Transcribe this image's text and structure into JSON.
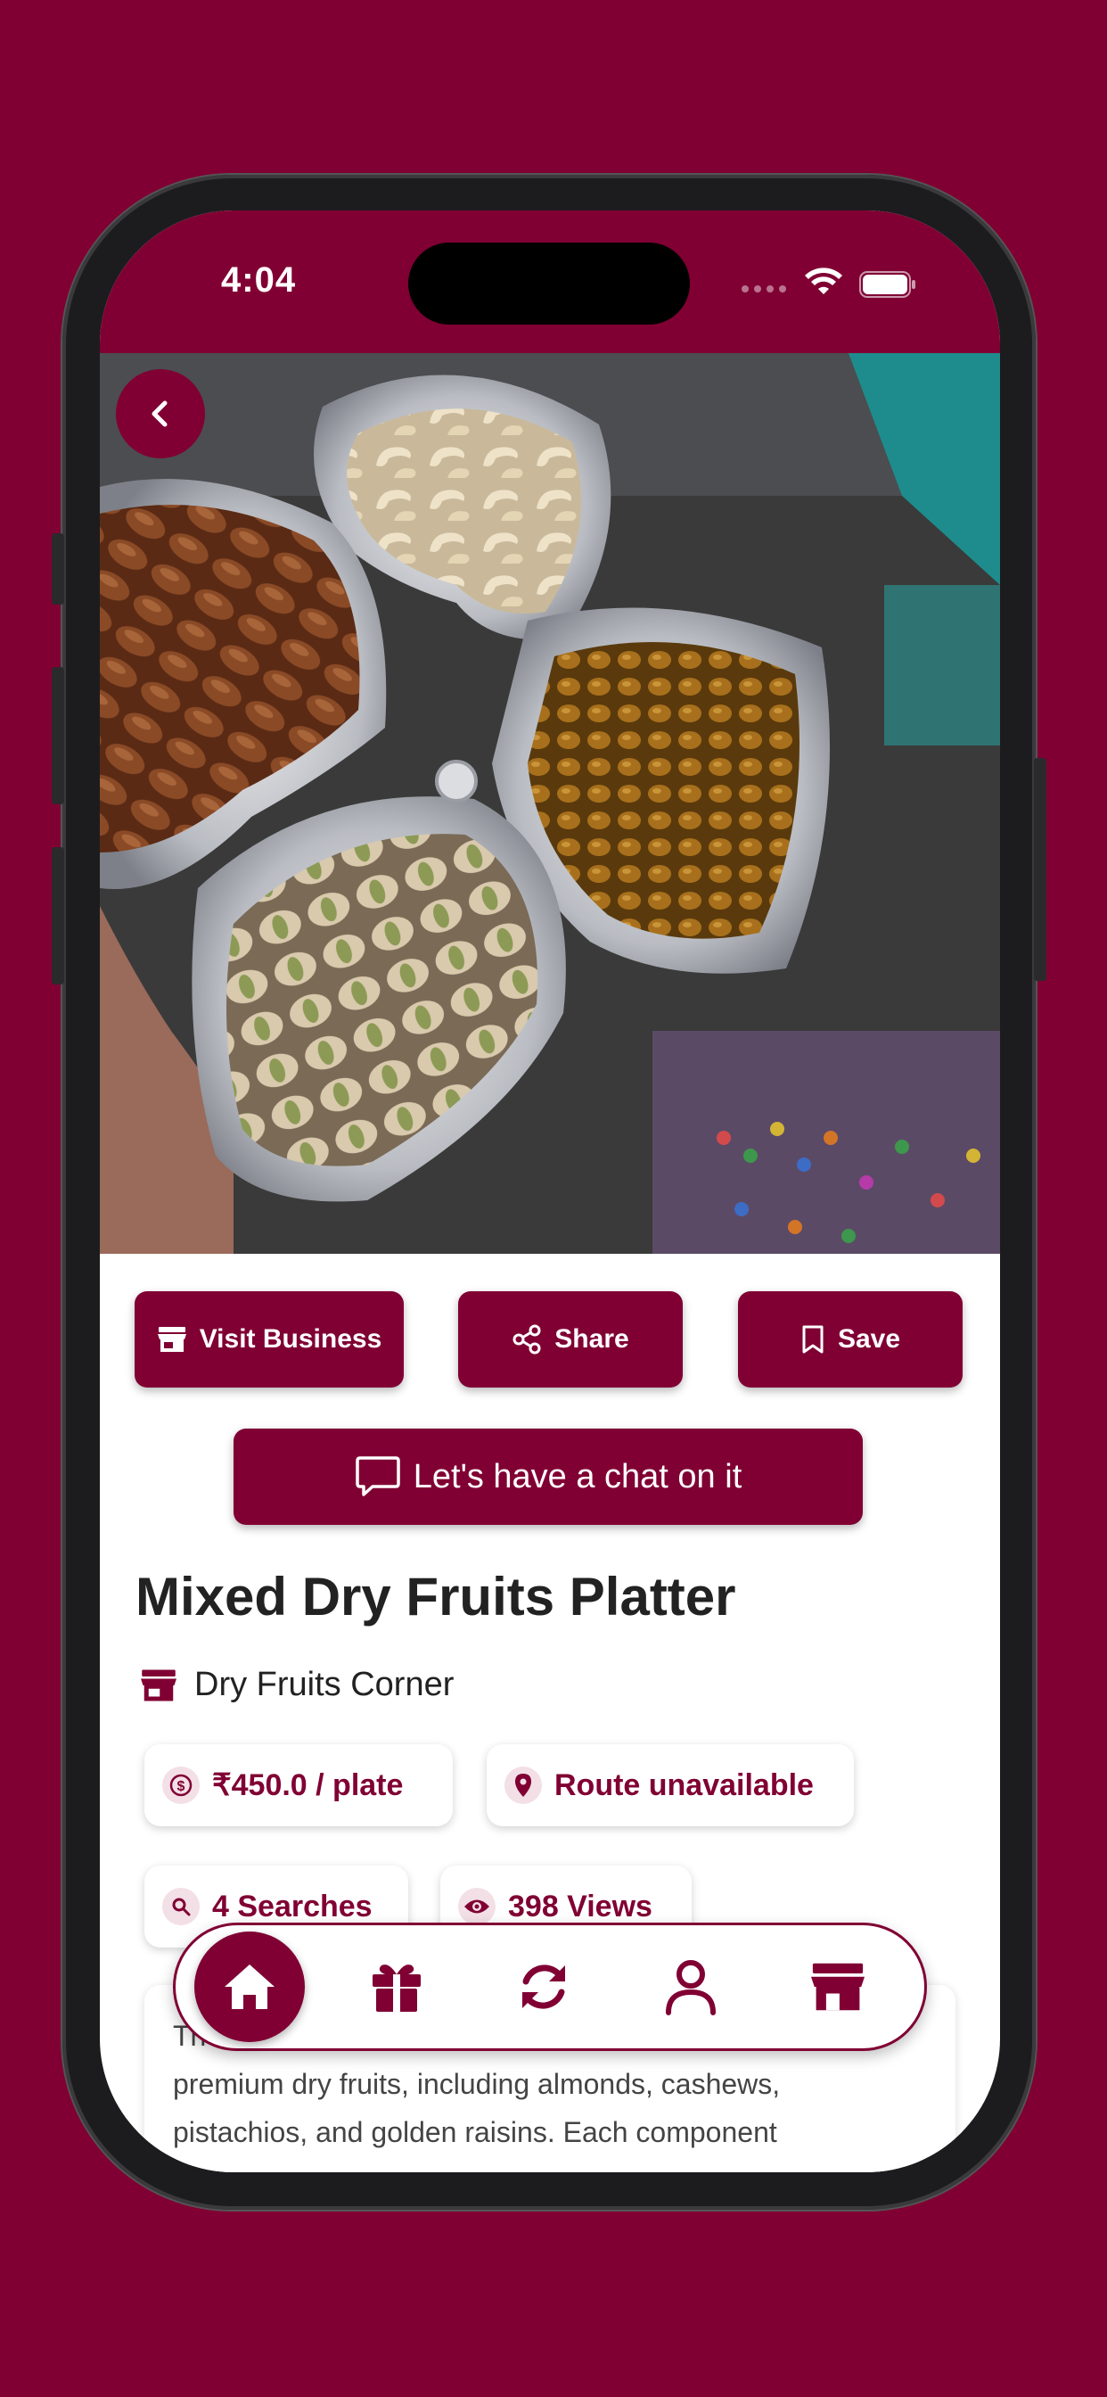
{
  "status_bar": {
    "time": "4:04"
  },
  "colors": {
    "brand": "#800033",
    "background": "#800033",
    "text_dark": "#222222",
    "chip_icon_bg": "#f3dfe6"
  },
  "hero": {
    "image_icon": "dry-fruits-platter-photo",
    "back_icon": "chevron-left-icon"
  },
  "actions": {
    "visit_business_label": "Visit Business",
    "share_label": "Share",
    "save_label": "Save",
    "chat_label": "Let's have a chat on it"
  },
  "product": {
    "title": "Mixed Dry Fruits Platter",
    "business_name": "Dry Fruits Corner",
    "price": "₹450.0 / plate",
    "route": "Route unavailable",
    "searches": "4 Searches",
    "views": "398 Views",
    "description_lines": [
      "Th",
      "premium dry fruits, including almonds, cashews,",
      "pistachios, and golden raisins. Each component"
    ]
  },
  "bottom_nav": {
    "items": [
      "home-icon",
      "gift-icon",
      "refresh-icon",
      "profile-icon",
      "store-icon"
    ],
    "active_index": 0
  }
}
